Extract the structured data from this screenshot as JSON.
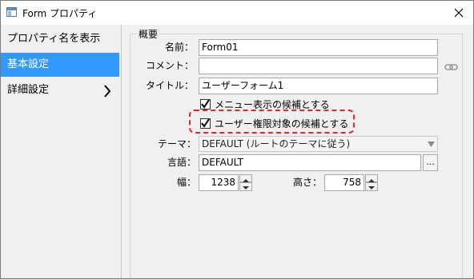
{
  "window": {
    "title": "Form プロパティ"
  },
  "sidebar": {
    "items": [
      {
        "label": "プロパティ名を表示",
        "selected": false
      },
      {
        "label": "基本設定",
        "selected": true
      },
      {
        "label": "詳細設定",
        "selected": false
      }
    ]
  },
  "form": {
    "group_title": "概要",
    "name_label": "名前：",
    "name_value": "Form01",
    "comment_label": "コメント：",
    "comment_value": "",
    "title_label": "タイトル：",
    "title_value": "ユーザーフォーム1",
    "show_in_menu_label": "メニュー表示の候補とする",
    "show_in_menu_checked": true,
    "user_permission_label": "ユーザー権限対象の候補とする",
    "user_permission_checked": true,
    "theme_label": "テーマ：",
    "theme_value": "DEFAULT (ルートのテーマに従う)",
    "language_label": "言語：",
    "language_value": "DEFAULT",
    "language_button": "...",
    "width_label": "幅：",
    "width_value": "1238",
    "height_label": "高さ：",
    "height_value": "758"
  },
  "colors": {
    "selection": "#3399ff",
    "highlight_border": "#e8262a"
  }
}
